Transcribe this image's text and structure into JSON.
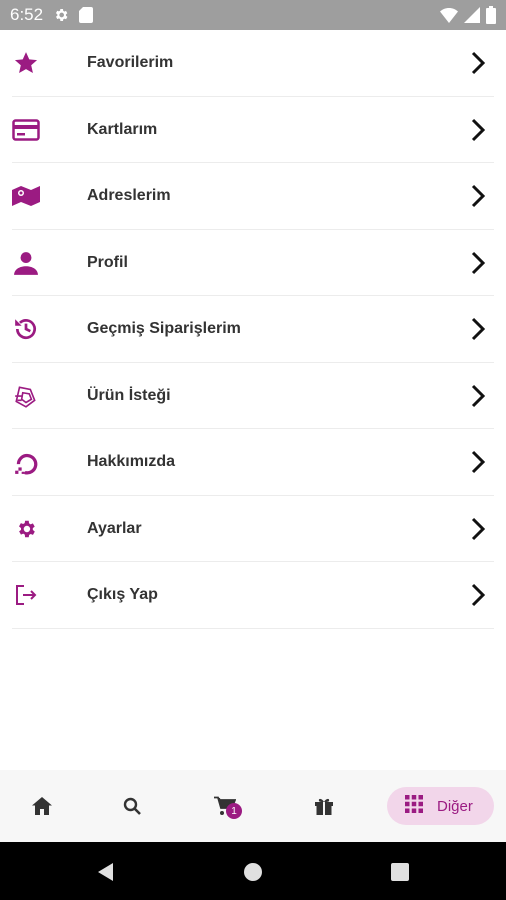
{
  "status_bar": {
    "time": "6:52",
    "icons": [
      "settings-icon",
      "sd-card-icon",
      "wifi-icon",
      "signal-icon",
      "battery-icon"
    ]
  },
  "menu": {
    "items": [
      {
        "label": "Favorilerim",
        "icon": "star-icon"
      },
      {
        "label": "Kartlarım",
        "icon": "credit-card-icon"
      },
      {
        "label": "Adreslerim",
        "icon": "map-icon"
      },
      {
        "label": "Profil",
        "icon": "person-icon"
      },
      {
        "label": "Geçmiş Siparişlerim",
        "icon": "history-icon"
      },
      {
        "label": "Ürün İsteği",
        "icon": "product-request-icon"
      },
      {
        "label": "Hakkımızda",
        "icon": "about-icon"
      },
      {
        "label": "Ayarlar",
        "icon": "settings-icon"
      },
      {
        "label": "Çıkış Yap",
        "icon": "logout-icon"
      }
    ]
  },
  "bottom_nav": {
    "items": [
      "home-icon",
      "search-icon",
      "cart-icon",
      "gift-icon"
    ],
    "cart_badge": "1",
    "more_label": "Diğer",
    "more_icon": "grid-icon"
  },
  "colors": {
    "accent": "#9b1b82",
    "accent_light": "#f2d6ea",
    "status_bar": "#9e9e9e",
    "text": "#333333"
  }
}
